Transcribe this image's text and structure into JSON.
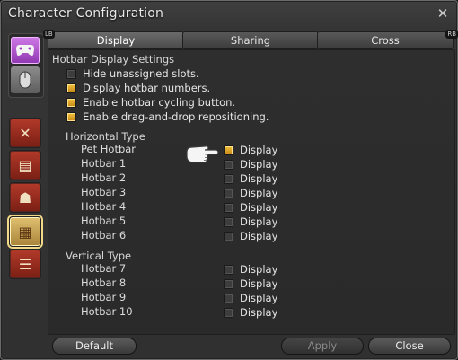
{
  "window": {
    "title": "Character Configuration",
    "close_icon": "close-x-icon"
  },
  "sidebar": {
    "devices": [
      {
        "name": "gamepad",
        "icon": "gamepad-icon",
        "color": "#c05ad8"
      },
      {
        "name": "mouse",
        "icon": "mouse-icon",
        "color": "#8a8a8a"
      }
    ],
    "categories": [
      {
        "name": "combat",
        "icon": "crossed-swords-icon",
        "glyph": "✕"
      },
      {
        "name": "card",
        "icon": "id-card-icon",
        "glyph": "▤"
      },
      {
        "name": "character",
        "icon": "character-icon",
        "glyph": "☗"
      },
      {
        "name": "hotbar",
        "icon": "checkered-hotbar-icon",
        "glyph": "▦"
      },
      {
        "name": "chat",
        "icon": "chat-bubble-icon",
        "glyph": "☰"
      }
    ]
  },
  "tabs": [
    {
      "label": "Display",
      "badge": "LB",
      "active": true
    },
    {
      "label": "Sharing",
      "active": false
    },
    {
      "label": "Cross",
      "badge": "RB",
      "active": false
    }
  ],
  "hotbar_settings": {
    "title": "Hotbar Display Settings",
    "options": [
      {
        "label": "Hide unassigned slots.",
        "checked": false
      },
      {
        "label": "Display hotbar numbers.",
        "checked": true
      },
      {
        "label": "Enable hotbar cycling button.",
        "checked": true
      },
      {
        "label": "Enable drag-and-drop repositioning.",
        "checked": true
      }
    ]
  },
  "horizontal": {
    "title": "Horizontal Type",
    "display_label": "Display",
    "bars": [
      {
        "name": "Pet Hotbar",
        "checked": true
      },
      {
        "name": "Hotbar 1",
        "checked": false
      },
      {
        "name": "Hotbar 2",
        "checked": false
      },
      {
        "name": "Hotbar 3",
        "checked": false
      },
      {
        "name": "Hotbar 4",
        "checked": false
      },
      {
        "name": "Hotbar 5",
        "checked": false
      },
      {
        "name": "Hotbar 6",
        "checked": false
      }
    ]
  },
  "vertical": {
    "title": "Vertical Type",
    "display_label": "Display",
    "bars": [
      {
        "name": "Hotbar 7",
        "checked": false
      },
      {
        "name": "Hotbar 8",
        "checked": false
      },
      {
        "name": "Hotbar 9",
        "checked": false
      },
      {
        "name": "Hotbar 10",
        "checked": false
      }
    ]
  },
  "buttons": {
    "default": "Default",
    "apply": "Apply",
    "close": "Close"
  },
  "cursor": {
    "icon": "pointing-hand-cursor-icon"
  }
}
